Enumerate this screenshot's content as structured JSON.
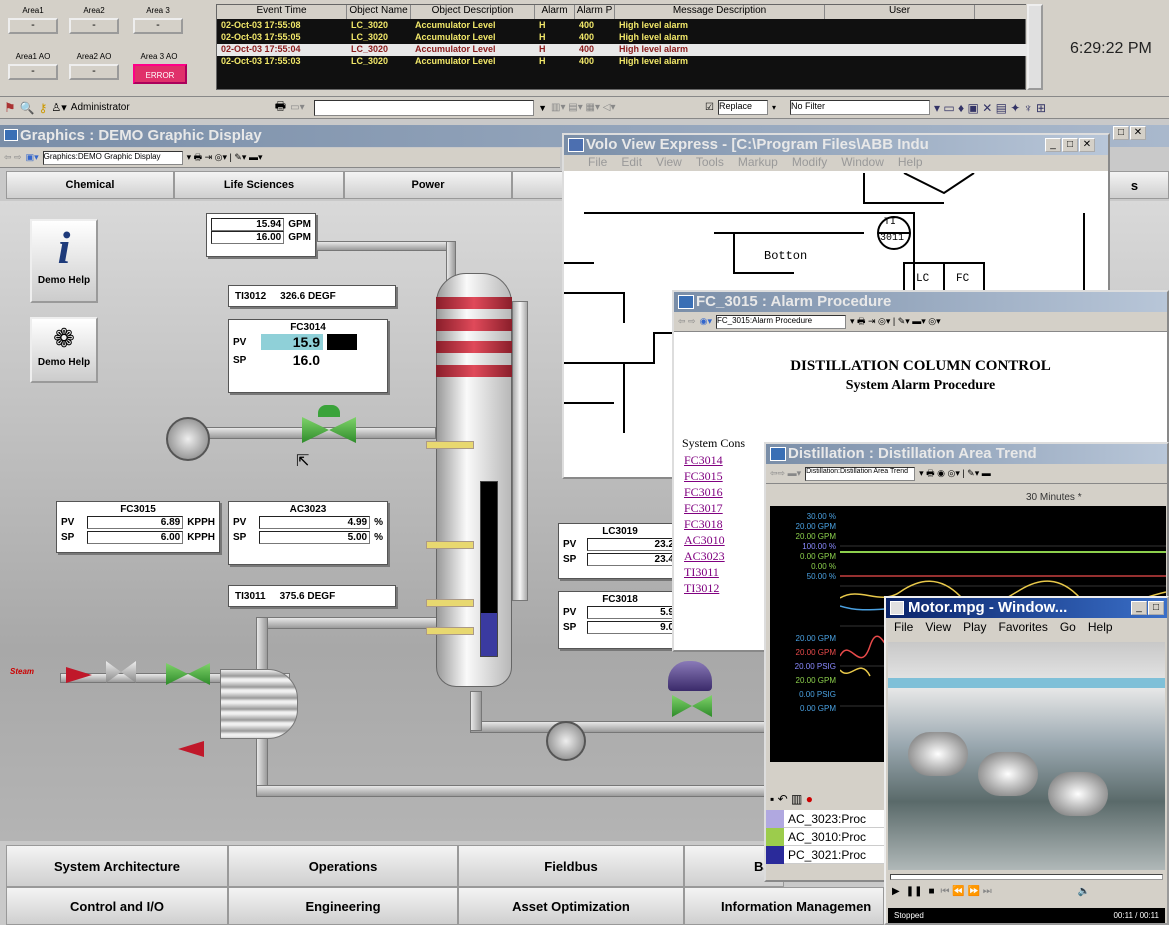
{
  "alarm_bar": {
    "areas": [
      {
        "label": "Area1",
        "value": "-"
      },
      {
        "label": "Area2",
        "value": "-"
      },
      {
        "label": "Area 3",
        "value": "-"
      },
      {
        "label": "Area1 AO",
        "value": "-"
      },
      {
        "label": "Area2 AO",
        "value": "-"
      },
      {
        "label": "Area 3 AO",
        "value": "ERROR",
        "state": "error"
      }
    ],
    "columns": [
      "Event Time",
      "Object Name",
      "Object Description",
      "Alarm",
      "Alarm P",
      "Message Description",
      "User"
    ],
    "rows": [
      [
        "02-Oct-03 17:55:08",
        "LC_3020",
        "Accumulator Level",
        "H",
        "400",
        "High level alarm",
        ""
      ],
      [
        "02-Oct-03 17:55:05",
        "LC_3020",
        "Accumulator Level",
        "H",
        "400",
        "High level alarm",
        ""
      ],
      [
        "02-Oct-03 17:55:04",
        "LC_3020",
        "Accumulator Level",
        "H",
        "400",
        "High level alarm",
        ""
      ],
      [
        "02-Oct-03 17:55:03",
        "LC_3020",
        "Accumulator Level",
        "H",
        "400",
        "High level alarm",
        ""
      ]
    ],
    "clock": "6:29:22 PM"
  },
  "toolbar": {
    "user": "Administrator",
    "replace": "Replace",
    "filter": "No Filter"
  },
  "graphics": {
    "title": "Graphics : DEMO Graphic Display",
    "address": "Graphics:DEMO Graphic Display",
    "tabs": [
      "Chemical",
      "Life Sciences",
      "Power"
    ],
    "help1": "Demo Help",
    "help2": "Demo Help",
    "flow1": "15.94",
    "flow1_unit": "GPM",
    "flow2": "16.00",
    "flow2_unit": "GPM",
    "ti3012_tag": "TI3012",
    "ti3012_val": "326.6 DEGF",
    "ti3011_tag": "TI3011",
    "ti3011_val": "375.6 DEGF",
    "fc3014": {
      "tag": "FC3014",
      "pv": "15.9",
      "sp": "16.0"
    },
    "fc3015": {
      "tag": "FC3015",
      "pv": "6.89",
      "sp": "6.00",
      "unit": "KPPH"
    },
    "ac3023": {
      "tag": "AC3023",
      "pv": "4.99",
      "sp": "5.00",
      "unit": "%"
    },
    "lc3019": {
      "tag": "LC3019",
      "pv": "23.2",
      "sp": "23.4"
    },
    "fc3018": {
      "tag": "FC3018",
      "pv": "5.9",
      "sp": "9.0"
    },
    "steam": "Steam",
    "pv_label": "PV",
    "sp_label": "SP",
    "bottom_nav": [
      "System Architecture",
      "Operations",
      "Fieldbus",
      "Bat",
      "Control and I/O",
      "Engineering",
      "Asset Optimization",
      "Information Managemen"
    ]
  },
  "volo": {
    "title": "Volo View Express - [C:\\Program Files\\ABB Indu",
    "menu": [
      "File",
      "Edit",
      "View",
      "Tools",
      "Markup",
      "Modify",
      "Window",
      "Help"
    ],
    "bottom_label": "Botton",
    "ti_tag": "TI",
    "ti_num": "3011",
    "lc": "LC",
    "fc": "FC"
  },
  "alarm_proc": {
    "title": "FC_3015 : Alarm Procedure",
    "address": "FC_3015:Alarm Procedure",
    "heading": "DISTILLATION COLUMN CONTROL",
    "subheading": "System Alarm Procedure",
    "section": "System Cons",
    "links": [
      "FC3014",
      "FC3015",
      "FC3016",
      "FC3017",
      "FC3018",
      "AC3010",
      "AC3023",
      "TI3011",
      "TI3012"
    ]
  },
  "trend": {
    "title": "Distillation : Distillation Area Trend",
    "address": "Distillation:Distillation Area Trend",
    "span": "30 Minutes *",
    "scale_top": [
      "30.00 %",
      "20.00 GPM",
      "20.00 GPM",
      "100.00 %",
      "0.00 GPM",
      "0.00 %",
      "50.00 %"
    ],
    "scale_bottom": [
      "20.00 GPM",
      "20.00 GPM",
      "20.00 PSIG",
      "20.00 GPM",
      "0.00 PSIG",
      "0.00 GPM"
    ],
    "legend": [
      "AC_3023:Proc",
      "AC_3010:Proc",
      "PC_3021:Proc"
    ],
    "legend_colors": [
      "#b0a8e0",
      "#9ccc4c",
      "#2a2a9a"
    ]
  },
  "media": {
    "title": "Motor.mpg - Window...",
    "menu": [
      "File",
      "View",
      "Play",
      "Favorites",
      "Go",
      "Help"
    ],
    "status": "Stopped",
    "time": "00:11 / 00:11"
  },
  "colors": {
    "alarm_bg": "#101010",
    "alarm_text": "#f2e86a",
    "selected_row": "#e8e8e8",
    "title_active": "#1f3f8f",
    "error": "#e0306a"
  }
}
